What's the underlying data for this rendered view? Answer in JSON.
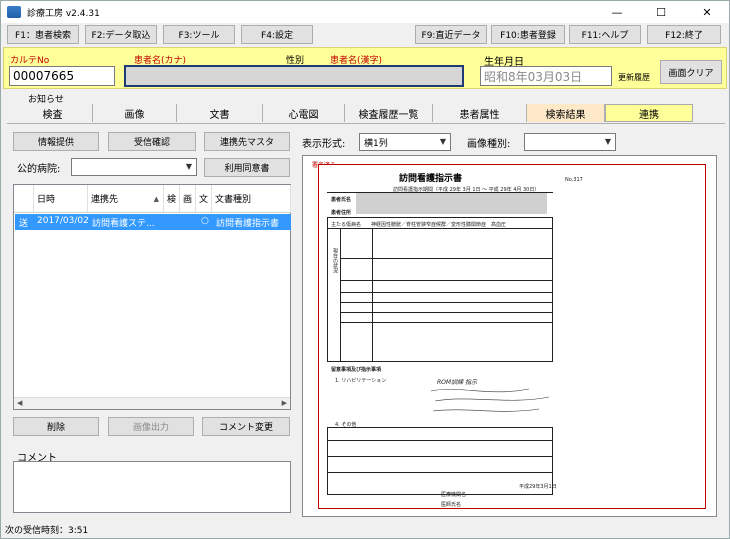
{
  "window": {
    "title": "診療工房 v2.4.31",
    "min_glyph": "—",
    "max_glyph": "☐",
    "close_glyph": "✕"
  },
  "fkeys": {
    "f1": "F1：患者検索",
    "f2": "F2:データ取込",
    "f3": "F3:ツール",
    "f4": "F4:設定",
    "f9": "F9:直近データ",
    "f10": "F10:患者登録",
    "f11": "F11:ヘルプ",
    "f12": "F12:終了"
  },
  "patient": {
    "karte_label": "カルテNo",
    "karte_value": "00007665",
    "kana_label": "患者名(カナ)",
    "sex_label": "性別",
    "kanji_label": "患者名(漢字)",
    "birth_label": "生年月日",
    "birth_value": "昭和8年03月03日",
    "history_label": "更新履歴",
    "clear_button": "画面クリア"
  },
  "tabs": {
    "notice": "お知らせ",
    "items": [
      "検査",
      "画像",
      "文書",
      "心電図",
      "検査履歴一覧",
      "患者属性",
      "検索結果",
      "連携"
    ]
  },
  "actions": {
    "info_provide": "情報提供",
    "receive_confirm": "受信確認",
    "partner_master": "連携先マスタ",
    "hospital_label": "公的病院:",
    "consent": "利用同意書",
    "display_format_label": "表示形式:",
    "display_format_value": "横1列",
    "image_type_label": "画像種別:",
    "delete": "削除",
    "image_output": "画像出力",
    "comment_change": "コメント変更",
    "comment_label": "コメント"
  },
  "grid": {
    "headers": [
      "日時",
      "連携先",
      "検",
      "画",
      "文",
      "文書種別"
    ],
    "sort_glyph": "▲",
    "rows": [
      {
        "type": "送",
        "date": "2017/03/02",
        "partner": "訪問看護ステ...",
        "ken": "",
        "ga": "",
        "bun": "○",
        "doc": "訪問看護指示書"
      }
    ]
  },
  "preview": {
    "stamp": "署名済み",
    "doc_title": "訪問看護指示書",
    "doc_no": "No.317",
    "period": "訪問看護指示期間（平成 29年 3月 1日 〜 平成 29年 4月 30日）",
    "patient_name_label": "患者氏名",
    "patient_address_label": "患者住所",
    "disease_label": "主たる傷病名",
    "disease_value": "神経因性膀胱／脊柱管狭窄症候群／変形性膝関節症　高血圧",
    "section_label_1": "現在の状況",
    "section_label_2": "留意事項及び指示事項",
    "rehab_label": "1. リハビリテーション",
    "other_label": "4. その他",
    "hospital_label": "医療機関名",
    "doctor_label": "医師氏名",
    "date_written": "平成29年3月1日",
    "handwriting": "ROM訓練 指示"
  },
  "status": {
    "text": "次の受信時刻：3:51"
  }
}
